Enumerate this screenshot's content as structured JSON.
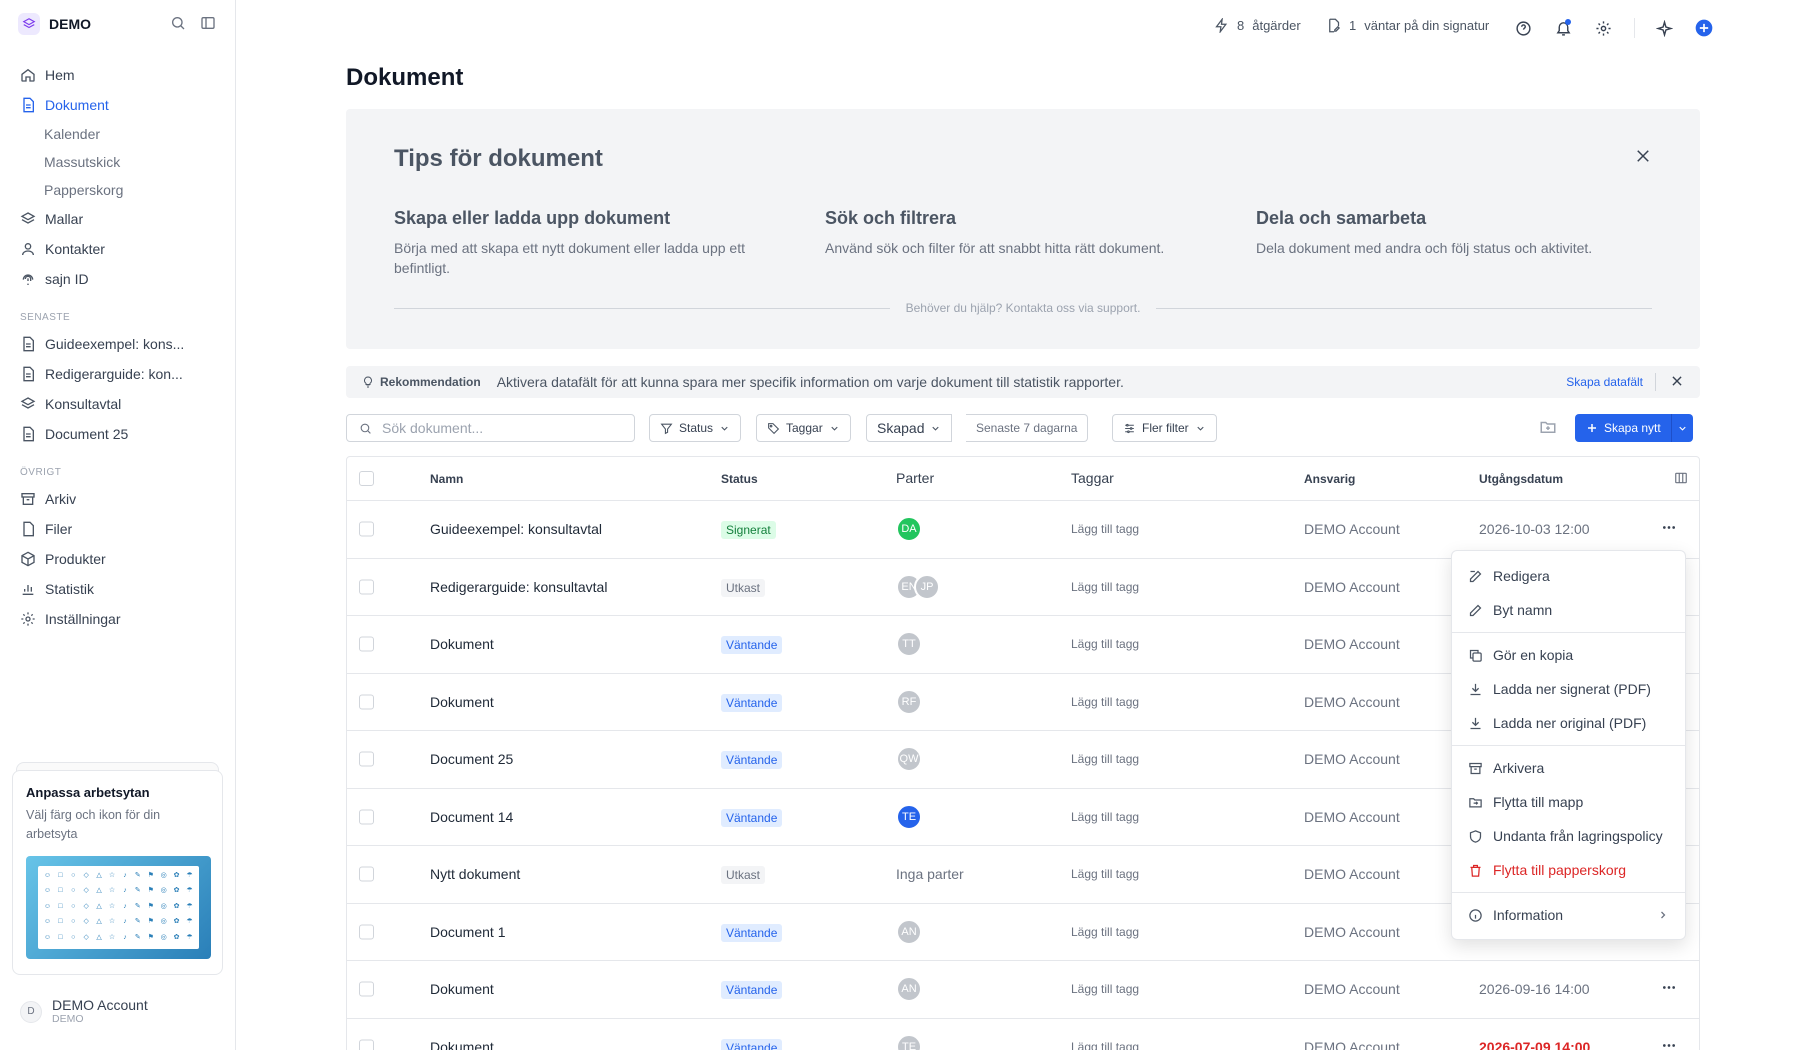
{
  "brand": {
    "name": "DEMO"
  },
  "nav": {
    "home": "Hem",
    "documents": "Dokument",
    "calendar": "Kalender",
    "bulk_send": "Massutskick",
    "trash": "Papperskorg",
    "templates": "Mallar",
    "contacts": "Kontakter",
    "sajn_id": "sajn ID"
  },
  "recent": {
    "label": "SENASTE",
    "items": [
      "Guideexempel: kons...",
      "Redigerarguide: kon...",
      "Konsultavtal",
      "Document 25"
    ]
  },
  "other": {
    "label": "ÖVRIGT",
    "archive": "Arkiv",
    "files": "Filer",
    "products": "Produkter",
    "statistics": "Statistik",
    "settings": "Inställningar"
  },
  "promo": {
    "title": "Anpassa arbetsytan",
    "text": "Välj färg och ikon för din arbetsyta"
  },
  "account": {
    "name": "DEMO Account",
    "workspace": "DEMO",
    "initial": "D"
  },
  "topbar": {
    "actions_count": "8",
    "actions_label": "åtgärder",
    "waiting_count": "1",
    "waiting_label": "väntar på din signatur"
  },
  "page": {
    "title": "Dokument"
  },
  "tips": {
    "title": "Tips för dokument",
    "columns": [
      {
        "title": "Skapa eller ladda upp dokument",
        "text": "Börja med att skapa ett nytt dokument eller ladda upp ett befintligt."
      },
      {
        "title": "Sök och filtrera",
        "text": "Använd sök och filter för att snabbt hitta rätt dokument."
      },
      {
        "title": "Dela och samarbeta",
        "text": "Dela dokument med andra och följ status och aktivitet."
      }
    ],
    "help": "Behöver du hjälp? Kontakta oss via support."
  },
  "recommendation": {
    "label": "Rekommendation",
    "text": "Aktivera datafält för att kunna spara mer specifik information om varje dokument till statistik rapporter.",
    "link": "Skapa datafält"
  },
  "toolbar": {
    "search_placeholder": "Sök dokument...",
    "status": "Status",
    "tags": "Taggar",
    "created": "Skapad",
    "range": "Senaste 7 dagarna",
    "more_filters": "Fler filter",
    "create": "Skapa nytt"
  },
  "table": {
    "headers": {
      "name": "Namn",
      "status": "Status",
      "parties": "Parter",
      "tags": "Taggar",
      "owner": "Ansvarig",
      "expires": "Utgångsdatum"
    },
    "add_tag": "Lägg till tagg",
    "rows": [
      {
        "name": "Guideexempel: konsultavtal",
        "status": "Signerat",
        "status_kind": "signed",
        "parties": [
          {
            "initials": "DA",
            "color": "green"
          }
        ],
        "owner": "DEMO Account",
        "expires": "2026-10-03 12:00",
        "expires_red": false
      },
      {
        "name": "Redigerarguide: konsultavtal",
        "status": "Utkast",
        "status_kind": "draft",
        "parties": [
          {
            "initials": "EN",
            "color": "grey"
          },
          {
            "initials": "JP",
            "color": "grey"
          }
        ],
        "owner": "DEMO Account",
        "expires": "",
        "expires_red": false
      },
      {
        "name": "Dokument",
        "status": "Väntande",
        "status_kind": "pending",
        "parties": [
          {
            "initials": "TT",
            "color": "grey"
          }
        ],
        "owner": "DEMO Account",
        "expires": "",
        "expires_red": false
      },
      {
        "name": "Dokument",
        "status": "Väntande",
        "status_kind": "pending",
        "parties": [
          {
            "initials": "RF",
            "color": "grey"
          }
        ],
        "owner": "DEMO Account",
        "expires": "",
        "expires_red": false
      },
      {
        "name": "Document 25",
        "status": "Väntande",
        "status_kind": "pending",
        "parties": [
          {
            "initials": "QW",
            "color": "grey"
          }
        ],
        "owner": "DEMO Account",
        "expires": "",
        "expires_red": false
      },
      {
        "name": "Document 14",
        "status": "Väntande",
        "status_kind": "pending",
        "parties": [
          {
            "initials": "TE",
            "color": "blue"
          }
        ],
        "owner": "DEMO Account",
        "expires": "",
        "expires_red": false
      },
      {
        "name": "Nytt dokument",
        "status": "Utkast",
        "status_kind": "draft",
        "parties": [],
        "no_parties": "Inga parter",
        "owner": "DEMO Account",
        "expires": "",
        "expires_red": false
      },
      {
        "name": "Document 1",
        "status": "Väntande",
        "status_kind": "pending",
        "parties": [
          {
            "initials": "AN",
            "color": "grey"
          }
        ],
        "owner": "DEMO Account",
        "expires": "",
        "expires_red": false
      },
      {
        "name": "Dokument",
        "status": "Väntande",
        "status_kind": "pending",
        "parties": [
          {
            "initials": "AN",
            "color": "grey"
          }
        ],
        "owner": "DEMO Account",
        "expires": "2026-09-16 14:00",
        "expires_red": false
      },
      {
        "name": "Dokument",
        "status": "Väntande",
        "status_kind": "pending",
        "parties": [
          {
            "initials": "TE",
            "color": "grey"
          }
        ],
        "owner": "DEMO Account",
        "expires": "2026-07-09 14:00",
        "expires_red": true
      }
    ]
  },
  "menu": {
    "edit": "Redigera",
    "rename": "Byt namn",
    "copy": "Gör en kopia",
    "download_signed": "Ladda ner signerat (PDF)",
    "download_original": "Ladda ner original (PDF)",
    "archive": "Arkivera",
    "move_folder": "Flytta till mapp",
    "exempt_policy": "Undanta från lagringspolicy",
    "move_trash": "Flytta till papperskorg",
    "information": "Information"
  },
  "colors": {
    "accent": "#2563eb",
    "danger": "#dc2626",
    "success": "#15803d"
  }
}
